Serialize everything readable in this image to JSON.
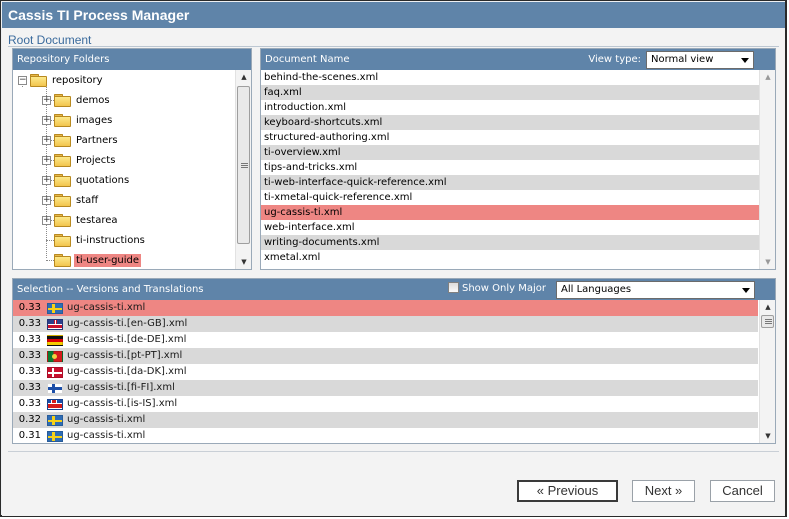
{
  "window": {
    "title": "Cassis TI Process Manager"
  },
  "breadcrumb": "Root Document",
  "folders_panel": {
    "header": "Repository Folders",
    "root": "repository",
    "items": [
      {
        "label": "demos",
        "expandable": true
      },
      {
        "label": "images",
        "expandable": true
      },
      {
        "label": "Partners",
        "expandable": true
      },
      {
        "label": "Projects",
        "expandable": true
      },
      {
        "label": "quotations",
        "expandable": true
      },
      {
        "label": "staff",
        "expandable": true
      },
      {
        "label": "testarea",
        "expandable": true
      },
      {
        "label": "ti-instructions",
        "expandable": false
      },
      {
        "label": "ti-user-guide",
        "expandable": false,
        "selected": true
      }
    ]
  },
  "documents_panel": {
    "header": "Document Name",
    "view_type_label": "View type:",
    "view_type_value": "Normal view",
    "items": [
      "behind-the-scenes.xml",
      "faq.xml",
      "introduction.xml",
      "keyboard-shortcuts.xml",
      "structured-authoring.xml",
      "ti-overview.xml",
      "tips-and-tricks.xml",
      "ti-web-interface-quick-reference.xml",
      "ti-xmetal-quick-reference.xml",
      "ug-cassis-ti.xml",
      "web-interface.xml",
      "writing-documents.xml",
      "xmetal.xml"
    ],
    "selected_index": 9
  },
  "selection_panel": {
    "header": "Selection -- Versions and Translations",
    "show_only_major_label": "Show Only Major",
    "language_value": "All Languages",
    "rows": [
      {
        "version": "0.33",
        "flag": "sweden-flag-icon",
        "file": "ug-cassis-ti.xml",
        "selected": true
      },
      {
        "version": "0.33",
        "flag": "uk-flag-icon",
        "file": "ug-cassis-ti.[en-GB].xml"
      },
      {
        "version": "0.33",
        "flag": "germany-flag-icon",
        "file": "ug-cassis-ti.[de-DE].xml"
      },
      {
        "version": "0.33",
        "flag": "portugal-flag-icon",
        "file": "ug-cassis-ti.[pt-PT].xml"
      },
      {
        "version": "0.33",
        "flag": "denmark-flag-icon",
        "file": "ug-cassis-ti.[da-DK].xml"
      },
      {
        "version": "0.33",
        "flag": "finland-flag-icon",
        "file": "ug-cassis-ti.[fi-FI].xml"
      },
      {
        "version": "0.33",
        "flag": "iceland-flag-icon",
        "file": "ug-cassis-ti.[is-IS].xml"
      },
      {
        "version": "0.32",
        "flag": "sweden-flag-icon",
        "file": "ug-cassis-ti.xml"
      },
      {
        "version": "0.31",
        "flag": "sweden-flag-icon",
        "file": "ug-cassis-ti.xml"
      }
    ]
  },
  "buttons": {
    "previous": "« Previous",
    "next": "Next »",
    "cancel": "Cancel"
  },
  "colors": {
    "header_blue": "#5f84a9",
    "selection_red": "#ee8683",
    "alt_row_gray": "#d9d9d9"
  }
}
